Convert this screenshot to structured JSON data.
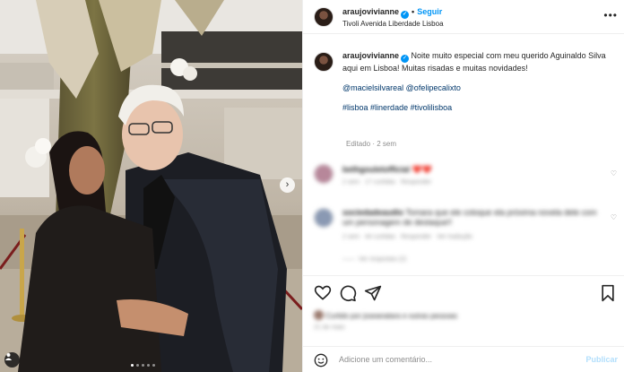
{
  "post": {
    "username": "araujovivianne",
    "dot": "•",
    "follow_label": "Seguir",
    "location": "Tivoli Avenida Liberdade Lisboa",
    "more_icon": "more-horizontal-icon"
  },
  "caption": {
    "username": "araujovivianne",
    "text": "Noite muito especial com meu querido Aguinaldo Silva aqui em Lisboa! Muitas risadas e muitas novidades!",
    "mentions": [
      "@macielsilvareal",
      "@ofelipecalixto"
    ],
    "hashtags": [
      "#lisboa",
      "#linerdade",
      "#tivolilisboa"
    ],
    "edited": "Editado · 2 sem"
  },
  "comments": [
    {
      "username": "bethgouletofficial",
      "text": "❤️❤️",
      "time": "2 sem",
      "likes": "17 curtidas",
      "reply_label": "Responder"
    },
    {
      "username": "sociedadeaudio",
      "text": "Tomara que ele coloque ela próxima novela dele com um personagem de destaque!!",
      "time": "2 sem",
      "likes": "44 curtidas",
      "reply_label": "Responder",
      "translate_label": "Ver tradução",
      "view_replies": "Ver respostas (2)"
    }
  ],
  "likes_text": "Curtido por joseanatara e outras pessoas",
  "date_text": "21 de maio",
  "composer": {
    "placeholder": "Adicione um comentário...",
    "publish_label": "Publicar"
  },
  "colors": {
    "accent": "#0095f6",
    "link": "#00376b",
    "muted": "#8e8e8e"
  }
}
